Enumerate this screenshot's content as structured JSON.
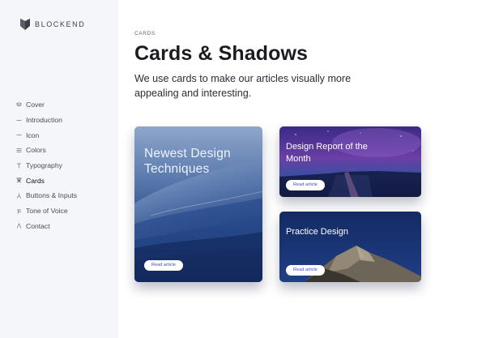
{
  "brand": {
    "name": "BLOCKEND"
  },
  "sidebar": {
    "items": [
      {
        "label": "Cover",
        "icon": "cover-icon",
        "active": false
      },
      {
        "label": "Introduction",
        "icon": "dash-icon",
        "active": false
      },
      {
        "label": "Icon",
        "icon": "dash-icon",
        "active": false
      },
      {
        "label": "Colors",
        "icon": "lines-icon",
        "active": false
      },
      {
        "label": "Typography",
        "icon": "typography-icon",
        "active": false
      },
      {
        "label": "Cards",
        "icon": "cards-icon",
        "active": true
      },
      {
        "label": "Buttons & Inputs",
        "icon": "buttons-icon",
        "active": false
      },
      {
        "label": "Tone of Voice",
        "icon": "voice-icon",
        "active": false
      },
      {
        "label": "Contact",
        "icon": "contact-icon",
        "active": false
      }
    ]
  },
  "main": {
    "eyebrow": "CARDS",
    "title": "Cards & Shadows",
    "lead": "We use cards to make our articles visually more appealing and interesting."
  },
  "cards": [
    {
      "title": "Newest Design Techniques",
      "button": "Read article",
      "image": "ocean-wave"
    },
    {
      "title": "Design Report of the Month",
      "button": "Read article",
      "image": "purple-night-sky-pier"
    },
    {
      "title": "Practice Design",
      "button": "Read article",
      "image": "mountain-peak-night"
    }
  ],
  "colors": {
    "sidebar_bg": "#f5f6f9",
    "button_text": "#3b4bd8",
    "title": "#1b1c22"
  }
}
